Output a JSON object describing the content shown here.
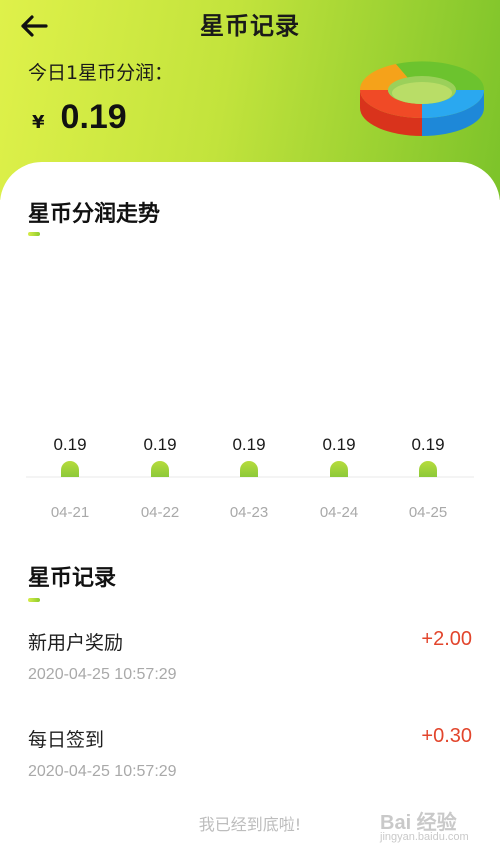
{
  "header": {
    "back_icon": "arrow-left-icon",
    "title": "星币记录",
    "today_label": "今日1星币分润：",
    "currency": "¥",
    "price": "0.19",
    "ring_icon": "donut-ring-icon",
    "colors": {
      "gradient_start": "#dff14a",
      "gradient_end": "#7cc32a"
    }
  },
  "trend": {
    "title": "星币分润走势"
  },
  "chart_data": {
    "type": "bar",
    "categories": [
      "04-21",
      "04-22",
      "04-23",
      "04-24",
      "04-25"
    ],
    "values": [
      0.19,
      0.19,
      0.19,
      0.19,
      0.19
    ],
    "data_labels": [
      "0.19",
      "0.19",
      "0.19",
      "0.19",
      "0.19"
    ],
    "title": "星币分润走势",
    "xlabel": "",
    "ylabel": "",
    "ylim": [
      0,
      0.19
    ],
    "grid": false,
    "legend": "none"
  },
  "records": {
    "title": "星币记录",
    "items": [
      {
        "name": "新用户奖励",
        "amount": "+2.00",
        "time": "2020-04-25 10:57:29"
      },
      {
        "name": "每日签到",
        "amount": "+0.30",
        "time": "2020-04-25 10:57:29"
      }
    ],
    "amount_color": "#e2452c"
  },
  "footer": {
    "end_note": "我已经到底啦!",
    "watermark": "Bai 经验",
    "watermark_sub": "jingyan.baidu.com"
  }
}
